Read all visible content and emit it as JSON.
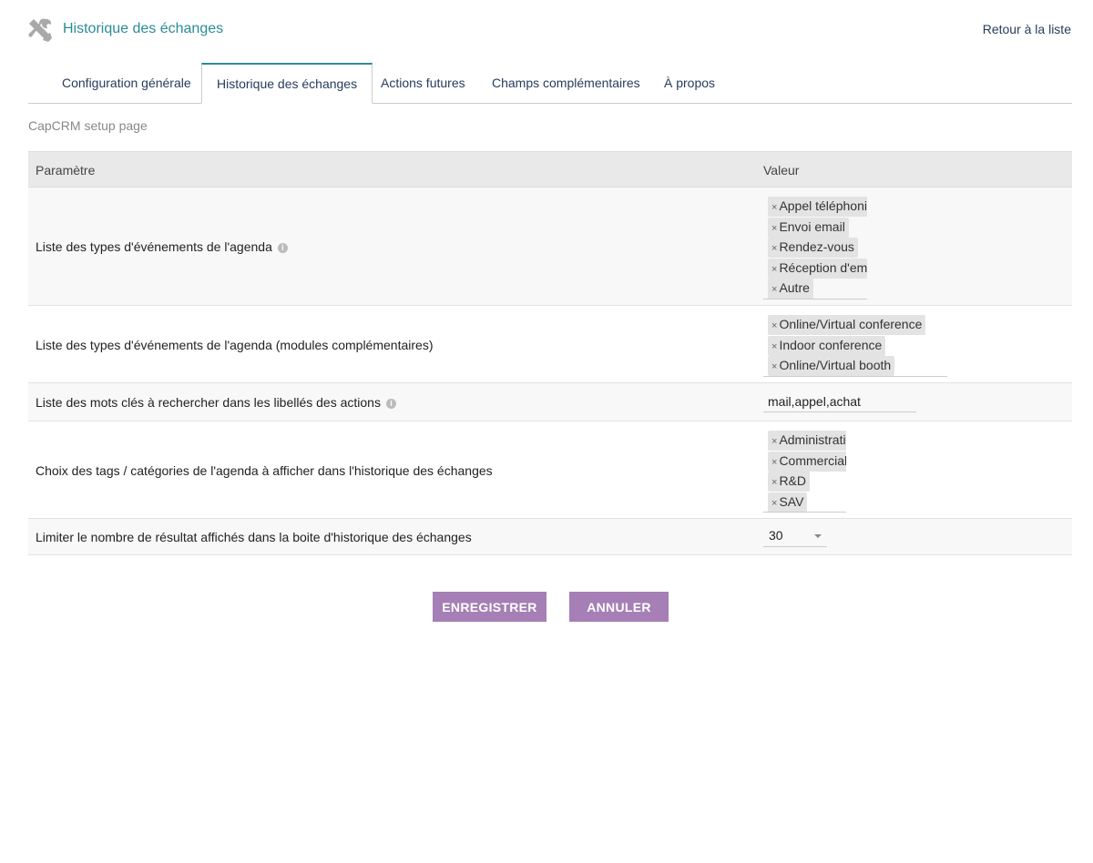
{
  "header": {
    "title": "Historique des échanges",
    "back_link": "Retour à la liste",
    "icon": "tools-icon",
    "accent_color": "#2b8c96"
  },
  "tabs": [
    {
      "label": "Configuration générale",
      "active": false
    },
    {
      "label": "Historique des échanges",
      "active": true
    },
    {
      "label": "Actions futures",
      "active": false
    },
    {
      "label": "Champs complémentaires",
      "active": false
    },
    {
      "label": "À propos",
      "active": false
    }
  ],
  "subtitle": "CapCRM setup page",
  "table": {
    "col_param": "Paramètre",
    "col_value": "Valeur",
    "rows": [
      {
        "label": "Liste des types d'événements de l'agenda",
        "has_info": true,
        "chips": [
          "Appel téléphonique",
          "Envoi email",
          "Rendez-vous",
          "Réception d'email",
          "Autre"
        ]
      },
      {
        "label": "Liste des types d'événements de l'agenda (modules complémentaires)",
        "has_info": false,
        "chips": [
          "Online/Virtual conference",
          "Indoor conference",
          "Online/Virtual booth"
        ]
      },
      {
        "label": "Liste des mots clés à rechercher dans les libellés des actions",
        "has_info": true,
        "value": "mail,appel,achat"
      },
      {
        "label": "Choix des tags / catégories de l'agenda à afficher dans l'historique des échanges",
        "has_info": false,
        "chips": [
          "Administratif",
          "Commercial",
          "R&D",
          "SAV"
        ]
      },
      {
        "label": "Limiter le nombre de résultat affichés dans la boite d'historique des échanges",
        "has_info": false,
        "select": "30"
      }
    ]
  },
  "buttons": {
    "save": "ENREGISTRER",
    "cancel": "ANNULER",
    "color": "#a57fb5"
  }
}
